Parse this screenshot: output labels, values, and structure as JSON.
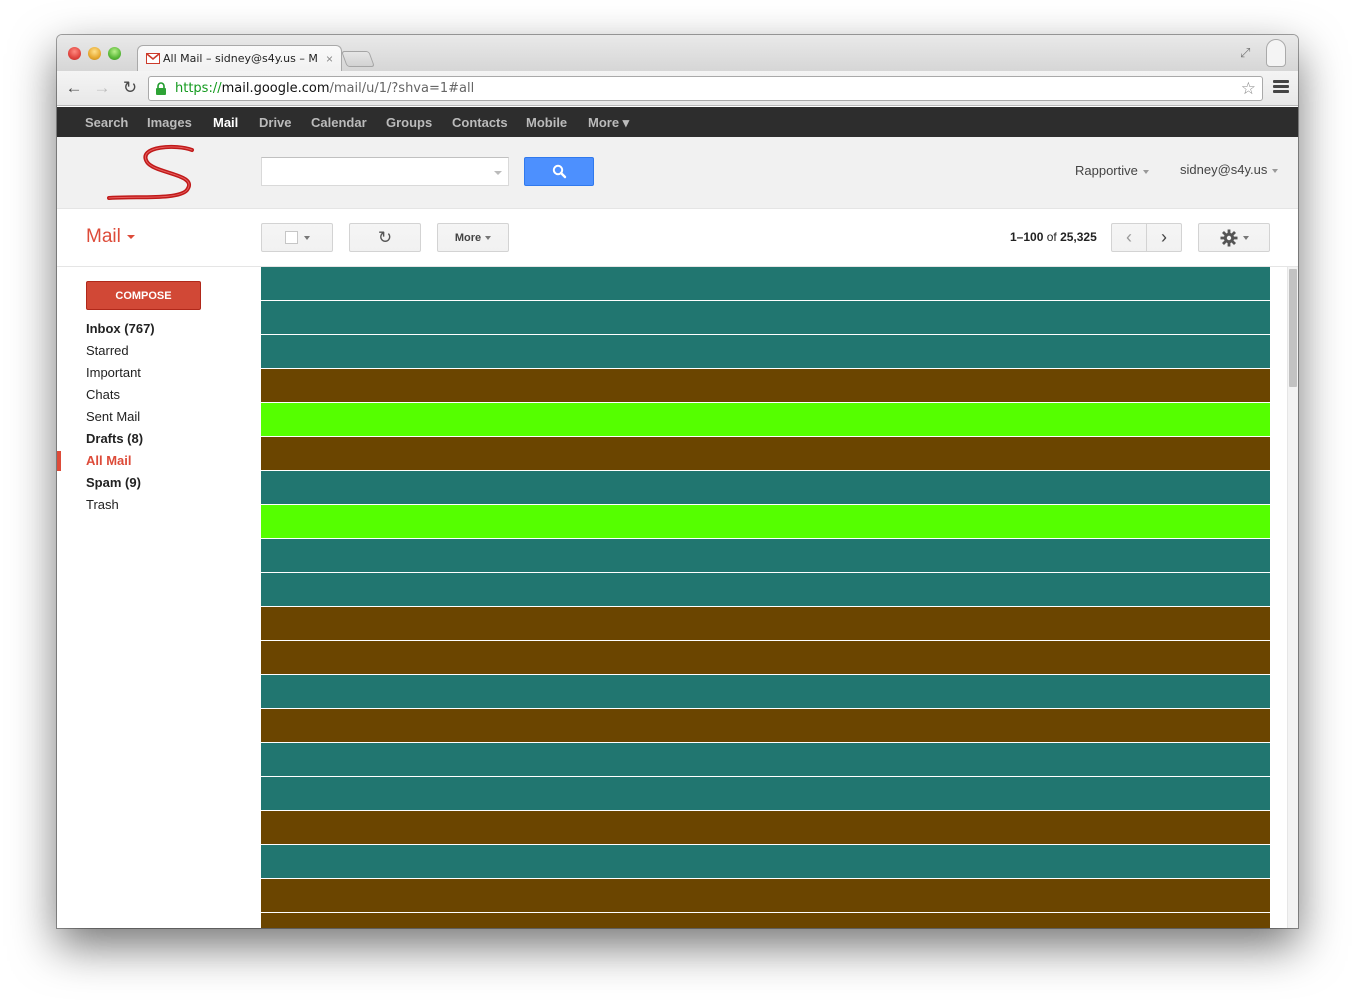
{
  "browser": {
    "tab_title": "All Mail – sidney@s4y.us – M",
    "tab_close": "×",
    "url_scheme": "https://",
    "url_host": "mail.google.com",
    "url_path": "/mail/u/1/?shva=1#all"
  },
  "gbar": {
    "items": [
      {
        "label": "Search"
      },
      {
        "label": "Images"
      },
      {
        "label": "Mail",
        "active": true
      },
      {
        "label": "Drive"
      },
      {
        "label": "Calendar"
      },
      {
        "label": "Groups"
      },
      {
        "label": "Contacts"
      },
      {
        "label": "Mobile"
      },
      {
        "label": "More ▾"
      }
    ]
  },
  "header": {
    "search_value": "",
    "rapportive_label": "Rapportive",
    "account_label": "sidney@s4y.us"
  },
  "toolbar": {
    "mail_label": "Mail",
    "more_label": "More",
    "pager_range": "1–100",
    "pager_of": "of",
    "pager_total": "25,325"
  },
  "sidebar": {
    "compose_label": "COMPOSE",
    "folders": [
      {
        "label": "Inbox (767)",
        "bold": true
      },
      {
        "label": "Starred"
      },
      {
        "label": "Important"
      },
      {
        "label": "Chats"
      },
      {
        "label": "Sent Mail"
      },
      {
        "label": "Drafts (8)",
        "bold": true
      },
      {
        "label": "All Mail",
        "active": true
      },
      {
        "label": "Spam (9)",
        "bold": true
      },
      {
        "label": "Trash"
      }
    ]
  },
  "colors": {
    "teal": "#217670",
    "brown": "#6b4500",
    "green": "#55ff00",
    "accent_red": "#dd4b39"
  },
  "message_rows": [
    "teal",
    "teal",
    "teal",
    "brown",
    "green",
    "brown",
    "teal",
    "green",
    "teal",
    "teal",
    "brown",
    "brown",
    "teal",
    "brown",
    "teal",
    "teal",
    "brown",
    "teal",
    "brown",
    "brown"
  ]
}
